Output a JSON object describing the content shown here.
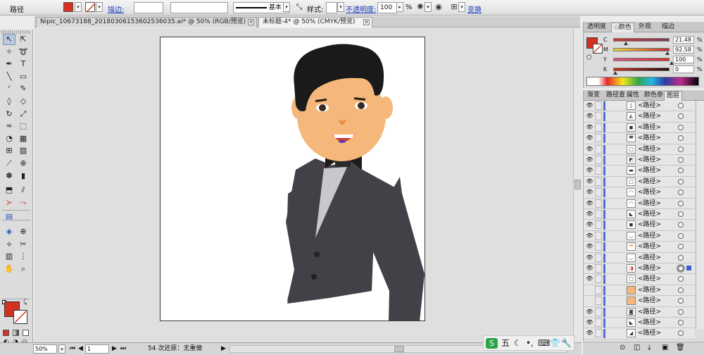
{
  "control_bar": {
    "selection_label": "路径",
    "fill_color": "#d33121",
    "stroke_link": "描边:",
    "stroke_profile": "基本",
    "style_label": "样式:",
    "opacity_link": "不透明度:",
    "opacity_value": "100",
    "opacity_unit": "%",
    "transform_link": "变换"
  },
  "doc_tabs": [
    {
      "label": "Nipic_10673188_20180306153602536035.ai* @ 50% (RGB/预览)"
    },
    {
      "label": "未标题-4* @ 50% (CMYK/预览)"
    }
  ],
  "tools": [
    "selection-tool",
    "direct-selection-tool",
    "magic-wand-tool",
    "lasso-tool",
    "pen-tool",
    "type-tool",
    "line-tool",
    "rectangle-tool",
    "paintbrush-tool",
    "pencil-tool",
    "blob-brush-tool",
    "eraser-tool",
    "rotate-tool",
    "scale-tool",
    "warp-tool",
    "free-transform-tool",
    "shape-builder-tool",
    "perspective-grid-tool",
    "mesh-tool",
    "gradient-tool",
    "eyedropper-tool",
    "blend-tool",
    "symbol-sprayer-tool",
    "column-graph-tool",
    "artboard-tool",
    "slice-tool",
    "width-tool",
    "reshape-tool",
    "live-paint-tool",
    "live-paint-select-tool",
    "crosshair-tool",
    "knife-tool",
    "scissors-tool",
    "chart-tool",
    "align-tool",
    "hand-tool",
    "zoom-tool"
  ],
  "color_panel": {
    "tabs": [
      "透明度",
      "颜色",
      "外观",
      "描边"
    ],
    "channels": [
      {
        "label": "C",
        "value": "21.48",
        "unit": "%"
      },
      {
        "label": "M",
        "value": "92.58",
        "unit": "%"
      },
      {
        "label": "Y",
        "value": "100",
        "unit": "%"
      },
      {
        "label": "K",
        "value": "0",
        "unit": "%"
      }
    ],
    "fill_color": "#d33121"
  },
  "layers_panel": {
    "tabs": [
      "渐变",
      "路径查",
      "属性",
      "颜色参",
      "图层"
    ],
    "rows": [
      {
        "name": "<路径>",
        "visible": true
      },
      {
        "name": "<路径>",
        "visible": true
      },
      {
        "name": "<路径>",
        "visible": true
      },
      {
        "name": "<路径>",
        "visible": true
      },
      {
        "name": "<路径>",
        "visible": true
      },
      {
        "name": "<路径>",
        "visible": true
      },
      {
        "name": "<路径>",
        "visible": true
      },
      {
        "name": "<路径>",
        "visible": true
      },
      {
        "name": "<路径>",
        "visible": true
      },
      {
        "name": "<路径>",
        "visible": true
      },
      {
        "name": "<路径>",
        "visible": true
      },
      {
        "name": "<路径>",
        "visible": true
      },
      {
        "name": "<路径>",
        "visible": true
      },
      {
        "name": "<路径>",
        "visible": true
      },
      {
        "name": "<路径>",
        "visible": true
      },
      {
        "name": "<路径>",
        "visible": true
      },
      {
        "name": "<路径>",
        "visible": true
      },
      {
        "name": "<路径>",
        "visible": false
      },
      {
        "name": "<路径>",
        "visible": false
      },
      {
        "name": "<路径>",
        "visible": true
      },
      {
        "name": "<路径>",
        "visible": true
      },
      {
        "name": "<路径>",
        "visible": true
      }
    ]
  },
  "status_bar": {
    "zoom": "50%",
    "artboard_number": "1",
    "undo_status": "54 次还原：无重做"
  },
  "ime_bar": {
    "label": "五"
  }
}
